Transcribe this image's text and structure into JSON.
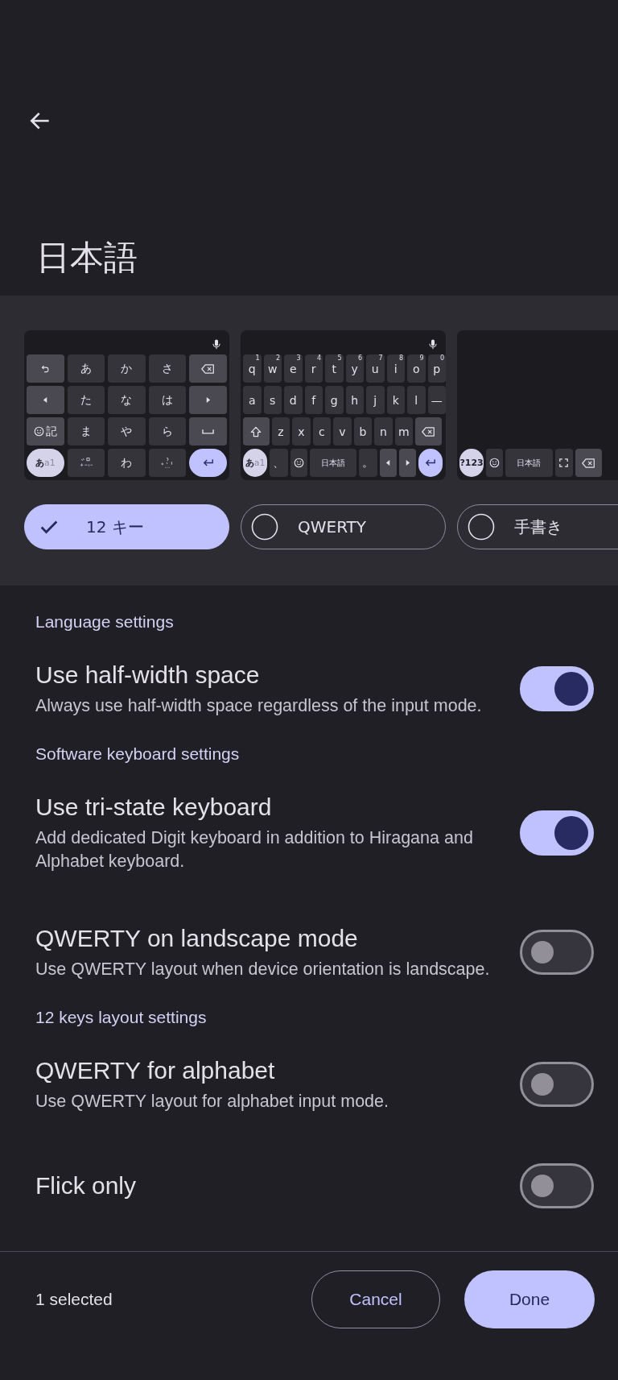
{
  "header": {
    "title": "日本語"
  },
  "layouts": [
    {
      "label": "12 キー",
      "selected": true,
      "keyboard": {
        "rows": [
          [
            {
              "kind": "undo"
            },
            {
              "kind": "text",
              "label": "あ"
            },
            {
              "kind": "text",
              "label": "か"
            },
            {
              "kind": "text",
              "label": "さ"
            },
            {
              "kind": "backspace"
            }
          ],
          [
            {
              "kind": "left"
            },
            {
              "kind": "text",
              "label": "た"
            },
            {
              "kind": "text",
              "label": "な"
            },
            {
              "kind": "text",
              "label": "は"
            },
            {
              "kind": "right"
            }
          ],
          [
            {
              "kind": "symbols",
              "label": "記"
            },
            {
              "kind": "text",
              "label": "ま"
            },
            {
              "kind": "text",
              "label": "や"
            },
            {
              "kind": "text",
              "label": "ら"
            },
            {
              "kind": "space"
            }
          ],
          [
            {
              "kind": "mode",
              "label": "あ",
              "sub": "a1"
            },
            {
              "kind": "dakuten"
            },
            {
              "kind": "text",
              "label": "わ"
            },
            {
              "kind": "punct"
            },
            {
              "kind": "enter"
            }
          ]
        ]
      }
    },
    {
      "label": "QWERTY",
      "selected": false,
      "keyboard": {
        "rows": [
          [
            {
              "kind": "text",
              "label": "q",
              "hint": "1"
            },
            {
              "kind": "text",
              "label": "w",
              "hint": "2"
            },
            {
              "kind": "text",
              "label": "e",
              "hint": "3"
            },
            {
              "kind": "text",
              "label": "r",
              "hint": "4"
            },
            {
              "kind": "text",
              "label": "t",
              "hint": "5"
            },
            {
              "kind": "text",
              "label": "y",
              "hint": "6"
            },
            {
              "kind": "text",
              "label": "u",
              "hint": "7"
            },
            {
              "kind": "text",
              "label": "i",
              "hint": "8"
            },
            {
              "kind": "text",
              "label": "o",
              "hint": "9"
            },
            {
              "kind": "text",
              "label": "p",
              "hint": "0"
            }
          ],
          [
            {
              "kind": "text",
              "label": "a"
            },
            {
              "kind": "text",
              "label": "s"
            },
            {
              "kind": "text",
              "label": "d"
            },
            {
              "kind": "text",
              "label": "f"
            },
            {
              "kind": "text",
              "label": "g"
            },
            {
              "kind": "text",
              "label": "h"
            },
            {
              "kind": "text",
              "label": "j"
            },
            {
              "kind": "text",
              "label": "k"
            },
            {
              "kind": "text",
              "label": "l"
            },
            {
              "kind": "text",
              "label": "—"
            }
          ],
          [
            {
              "kind": "shift"
            },
            {
              "kind": "text",
              "label": "z"
            },
            {
              "kind": "text",
              "label": "x"
            },
            {
              "kind": "text",
              "label": "c"
            },
            {
              "kind": "text",
              "label": "v"
            },
            {
              "kind": "text",
              "label": "b"
            },
            {
              "kind": "text",
              "label": "n"
            },
            {
              "kind": "text",
              "label": "m"
            },
            {
              "kind": "backspace"
            }
          ],
          [
            {
              "kind": "mode",
              "label": "あ",
              "sub": "a1"
            },
            {
              "kind": "text",
              "label": "、"
            },
            {
              "kind": "emoji"
            },
            {
              "kind": "text",
              "label": "日本語"
            },
            {
              "kind": "text",
              "label": "。"
            },
            {
              "kind": "left"
            },
            {
              "kind": "right"
            },
            {
              "kind": "enter"
            }
          ]
        ]
      }
    },
    {
      "label": "手書き",
      "selected": false,
      "keyboard": {
        "rows": [
          [
            {
              "kind": "mode",
              "label": "?123"
            },
            {
              "kind": "emoji"
            },
            {
              "kind": "text",
              "label": "日本語"
            },
            {
              "kind": "fullscreen"
            },
            {
              "kind": "backspace"
            }
          ]
        ]
      }
    }
  ],
  "sections": [
    {
      "title": "Language settings",
      "items": [
        {
          "title": "Use half-width space",
          "subtitle": "Always use half-width space regardless of the input mode.",
          "on": true
        }
      ]
    },
    {
      "title": "Software keyboard settings",
      "items": [
        {
          "title": "Use tri-state keyboard",
          "subtitle": "Add dedicated Digit keyboard in addition to Hiragana and Alphabet keyboard.",
          "on": true
        },
        {
          "title": "QWERTY on landscape mode",
          "subtitle": "Use QWERTY layout when device orientation is landscape.",
          "on": false
        }
      ]
    },
    {
      "title": "12 keys layout settings",
      "items": [
        {
          "title": "QWERTY for alphabet",
          "subtitle": "Use QWERTY layout for alphabet input mode.",
          "on": false
        },
        {
          "title": "Flick only",
          "on": false
        }
      ]
    }
  ],
  "footer": {
    "status": "1 selected",
    "buttons": [
      {
        "label": "Cancel",
        "kind": "outlined"
      },
      {
        "label": "Done",
        "kind": "filled"
      }
    ]
  }
}
